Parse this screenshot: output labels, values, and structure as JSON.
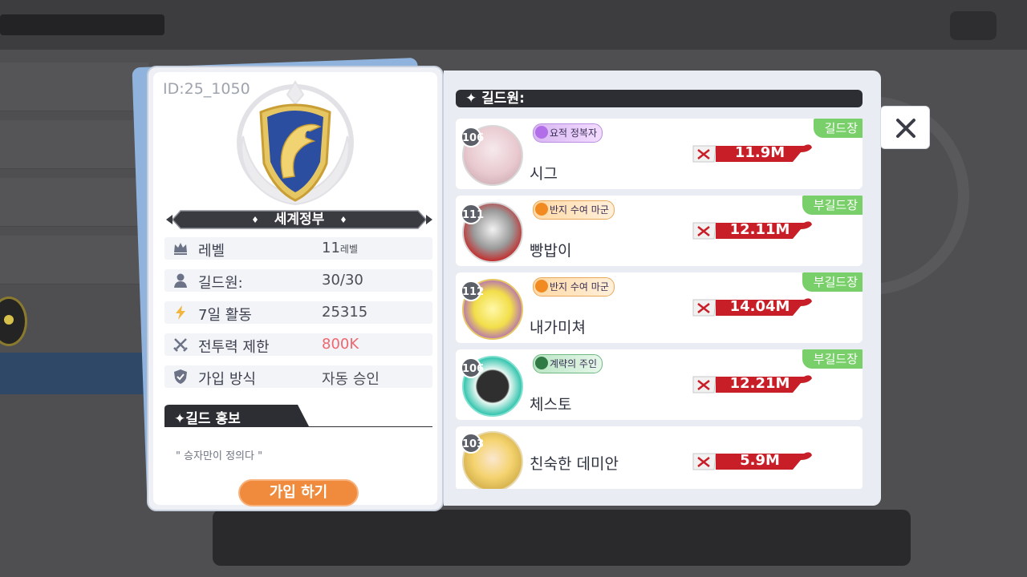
{
  "guild": {
    "id_text": "ID:25_1050",
    "name": "세계정부",
    "emblem_icon": "eagle-shield-icon",
    "info": [
      {
        "icon": "crown-icon",
        "label": "레벨",
        "value": "11",
        "unit": "레벨"
      },
      {
        "icon": "person-icon",
        "label": "길드원:",
        "value": "30/30",
        "unit": ""
      },
      {
        "icon": "lightning-icon",
        "label": "7일 활동",
        "value": "25315",
        "unit": ""
      },
      {
        "icon": "crossed-swords-icon",
        "label": "전투력 제한",
        "value": "800K",
        "unit": ""
      },
      {
        "icon": "shield-check-icon",
        "label": "가입 방식",
        "value": "자동 승인",
        "unit": ""
      }
    ],
    "promo_title": "길드 홍보",
    "promo_text": "\" 승자만이 정의다 \"",
    "join_button": "가입 하기"
  },
  "members": {
    "header": "길드원:",
    "list": [
      {
        "level": "106",
        "title": "요적 정복자",
        "name": "시그",
        "power": "11.9M",
        "role": "길드장"
      },
      {
        "level": "111",
        "title": "반지 수여 마군",
        "name": "빵밥이",
        "power": "12.11M",
        "role": "부길드장"
      },
      {
        "level": "112",
        "title": "반지 수여 마군",
        "name": "내가미쳐",
        "power": "14.04M",
        "role": "부길드장"
      },
      {
        "level": "106",
        "title": "계략의 주인",
        "name": "체스토",
        "power": "12.21M",
        "role": "부길드장"
      },
      {
        "level": "103",
        "title": "",
        "name": "친숙한 데미안",
        "power": "5.9M",
        "role": ""
      }
    ]
  },
  "colors": {
    "power_red": "#c81e27",
    "role_green": "#79d06a",
    "join_orange": "#f08a3c",
    "limit_red": "#ee6670"
  }
}
